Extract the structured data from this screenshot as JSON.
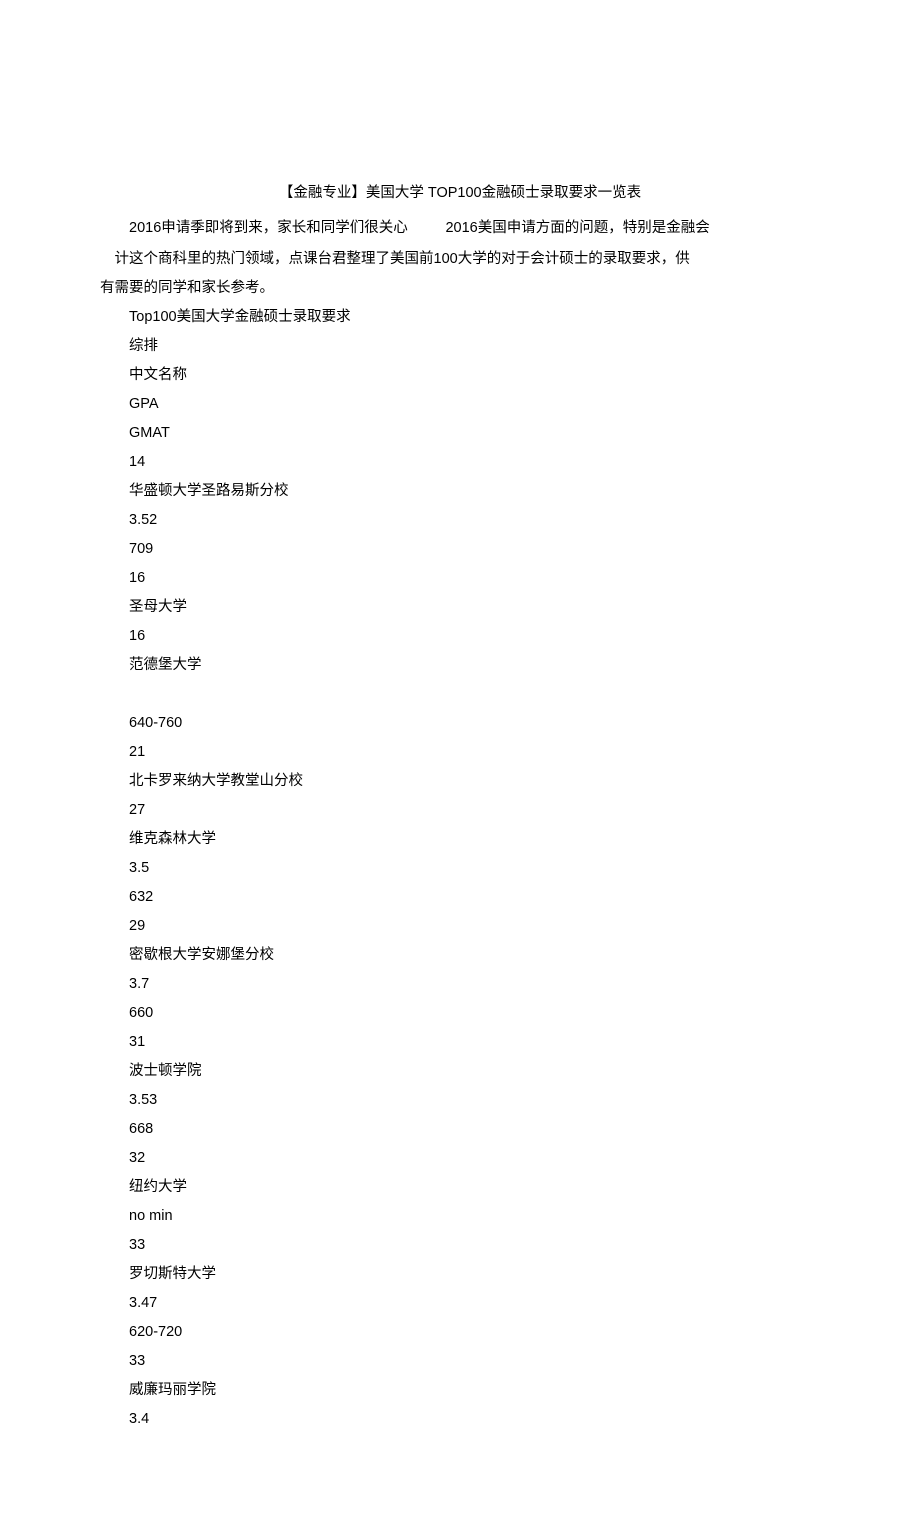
{
  "title": "【金融专业】美国大学 TOP100金融硕士录取要求一览表",
  "intro_a": "2016申请季即将到来，家长和同学们很关心",
  "intro_b": "2016美国申请方面的问题，特别是金融会",
  "intro_c": "计这个商科里的热门领域，点课台君整理了美国前",
  "intro_d": "100大学的对于会计硕士的录取要求，供",
  "intro_e": "有需要的同学和家长参考。",
  "subheading": "Top100美国大学金融硕士录取要求",
  "headers": {
    "rank": "综排",
    "name_cn": "中文名称",
    "gpa": "GPA",
    "gmat": "GMAT"
  },
  "rows": [
    {
      "rank": "14",
      "name_cn": "华盛顿大学圣路易斯分校",
      "gpa": "3.52",
      "gmat": "709"
    },
    {
      "rank": "16",
      "name_cn": "圣母大学",
      "gpa": "",
      "gmat": ""
    },
    {
      "rank": "16",
      "name_cn": "范德堡大学",
      "gpa": "",
      "gmat": "640-760",
      "blank_gpa_line": true
    },
    {
      "rank": "21",
      "name_cn": "北卡罗来纳大学教堂山分校",
      "gpa": "",
      "gmat": ""
    },
    {
      "rank": "27",
      "name_cn": "维克森林大学",
      "gpa": "3.5",
      "gmat": "632"
    },
    {
      "rank": "29",
      "name_cn": "密歇根大学安娜堡分校",
      "gpa": "3.7",
      "gmat": "660"
    },
    {
      "rank": "31",
      "name_cn": "波士顿学院",
      "gpa": "3.53",
      "gmat": "668"
    },
    {
      "rank": "32",
      "name_cn": "纽约大学",
      "gpa": "no min",
      "gmat": ""
    },
    {
      "rank": "33",
      "name_cn": "罗切斯特大学",
      "gpa": "3.47",
      "gmat": "620-720"
    },
    {
      "rank": "33",
      "name_cn": "威廉玛丽学院",
      "gpa": "3.4",
      "gmat": ""
    }
  ]
}
